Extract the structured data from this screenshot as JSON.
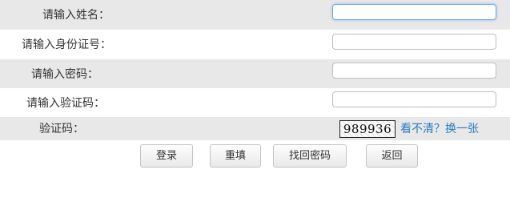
{
  "form": {
    "fields": [
      {
        "label": "请输入姓名：",
        "value": "",
        "placeholder": ""
      },
      {
        "label": "请输入身份证号：",
        "value": "",
        "placeholder": ""
      },
      {
        "label": "请输入密码：",
        "value": "",
        "placeholder": ""
      },
      {
        "label": "请输入验证码：",
        "value": "",
        "placeholder": ""
      }
    ],
    "captcha": {
      "label": "验证码：",
      "code": "989936",
      "refresh_text": "看不清？换一张"
    }
  },
  "buttons": {
    "login": "登录",
    "reset": "重填",
    "recover": "找回密码",
    "back": "返回"
  },
  "colors": {
    "row_shade": "#e8e8e8",
    "link": "#2a7bbf",
    "focus_border": "#6aa9e9"
  }
}
